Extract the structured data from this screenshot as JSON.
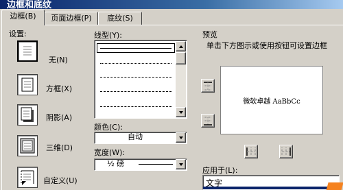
{
  "window": {
    "title": "边框和底纹"
  },
  "tabs": [
    {
      "label": "边框(B)",
      "active": true
    },
    {
      "label": "页面边框(P)",
      "active": false
    },
    {
      "label": "底纹(S)",
      "active": false
    }
  ],
  "settings": {
    "heading": "设置:",
    "options": [
      {
        "label": "无(N)",
        "icon": "border-none-icon",
        "selected": true
      },
      {
        "label": "方框(X)",
        "icon": "border-box-icon",
        "selected": false
      },
      {
        "label": "阴影(A)",
        "icon": "border-shadow-icon",
        "selected": false
      },
      {
        "label": "三维(D)",
        "icon": "border-3d-icon",
        "selected": false
      },
      {
        "label": "自定义(U)",
        "icon": "border-custom-icon",
        "selected": false
      }
    ]
  },
  "style": {
    "heading": "线型(Y):",
    "lines": [
      "solid",
      "dotted",
      "dash-dot",
      "dashed",
      "long-dashed",
      "dash-dot-dot"
    ]
  },
  "color": {
    "label": "颜色(C):",
    "value": "自动"
  },
  "width": {
    "label": "宽度(W):",
    "value": "½ 磅"
  },
  "preview": {
    "heading": "预览",
    "instruction": "单击下方图示或使用按钮可设置边框",
    "sample_text": "微软卓越 AaBbCc"
  },
  "apply_to": {
    "label": "应用于(L):",
    "value": "文字"
  },
  "colors": {
    "dialog_bg": "#d4d0c8",
    "titlebar_start": "#0a246a",
    "titlebar_end": "#a6caf0",
    "watermark": "#f5821f"
  }
}
